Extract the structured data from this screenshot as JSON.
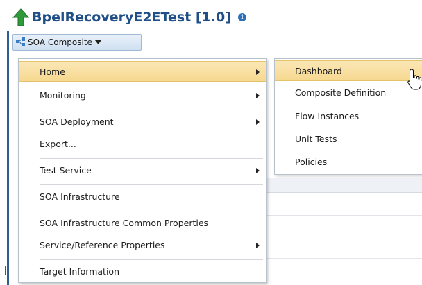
{
  "header": {
    "title": "BpelRecoveryE2ETest [1.0]",
    "info_glyph": "i",
    "composite_button_label": "SOA Composite"
  },
  "menu": {
    "items": [
      {
        "label": "Home",
        "has_submenu": true,
        "active": true
      },
      {
        "label": "Monitoring",
        "has_submenu": true
      },
      {
        "label": "SOA Deployment",
        "has_submenu": true
      },
      {
        "label": "Export...",
        "has_submenu": false
      },
      {
        "label": "Test Service",
        "has_submenu": true
      },
      {
        "label": "SOA Infrastructure",
        "has_submenu": false
      },
      {
        "label": "SOA Infrastructure Common Properties",
        "has_submenu": false
      },
      {
        "label": "Service/Reference Properties",
        "has_submenu": true
      },
      {
        "label": "Target Information",
        "has_submenu": false
      }
    ]
  },
  "submenu": {
    "items": [
      {
        "label": "Dashboard",
        "active": true
      },
      {
        "label": "Composite Definition"
      },
      {
        "label": "Flow Instances"
      },
      {
        "label": "Unit Tests"
      },
      {
        "label": "Policies"
      }
    ]
  },
  "icons": {
    "title": "green-up-arrow-icon",
    "info": "info-icon",
    "composite": "soa-composite-icon",
    "dropdown": "caret-down-icon",
    "cursor": "mouse-pointer-icon"
  },
  "colors": {
    "title": "#1f4f86",
    "highlight": "#f8de9d",
    "accent": "#2f5f92",
    "arrow_green": "#2e9a3a"
  }
}
